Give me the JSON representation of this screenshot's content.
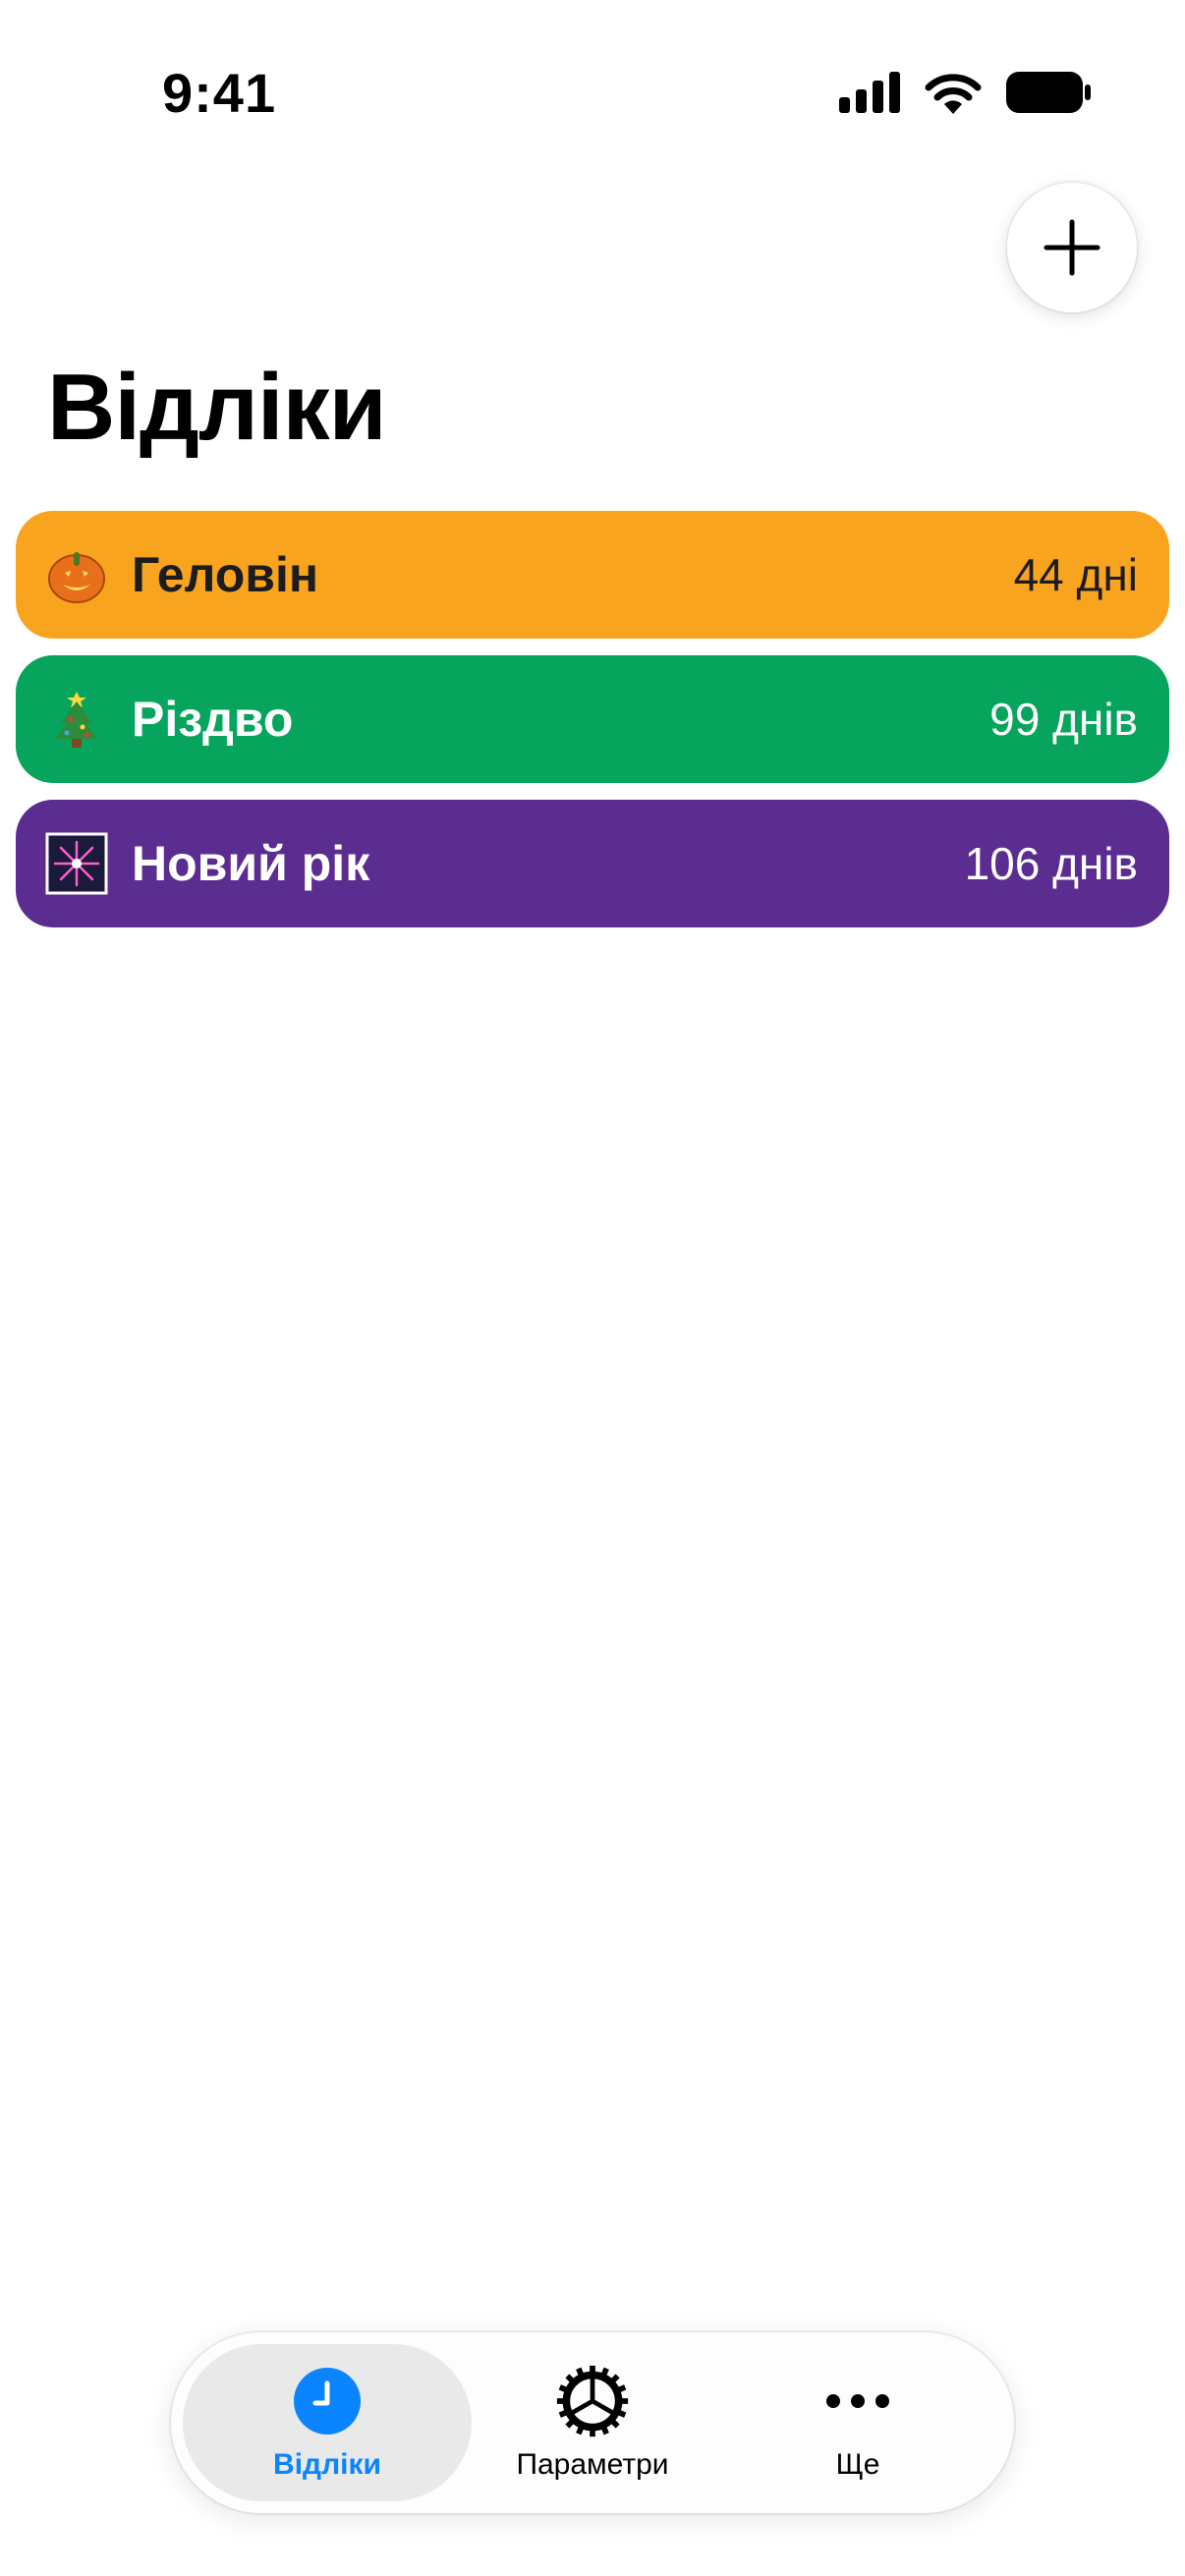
{
  "status_bar": {
    "time": "9:41"
  },
  "header": {
    "title": "Відліки",
    "add_icon": "plus-icon"
  },
  "countdowns": [
    {
      "emoji": "pumpkin",
      "name": "Геловін",
      "days": "44 дні",
      "color": "#F8A41F",
      "text_color": "#1c1c1e"
    },
    {
      "emoji": "christmas-tree",
      "name": "Різдво",
      "days": "99 днів",
      "color": "#06A45C",
      "text_color": "#ffffff"
    },
    {
      "emoji": "fireworks",
      "name": "Новий рік",
      "days": "106 днів",
      "color": "#5B2D91",
      "text_color": "#ffffff"
    }
  ],
  "tab_bar": {
    "tabs": [
      {
        "label": "Відліки",
        "icon": "clock-icon",
        "active": true
      },
      {
        "label": "Параметри",
        "icon": "gear-icon",
        "active": false
      },
      {
        "label": "Ще",
        "icon": "ellipsis-icon",
        "active": false
      }
    ],
    "accent": "#0A84FF"
  }
}
